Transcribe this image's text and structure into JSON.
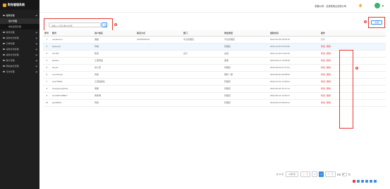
{
  "app": {
    "title": "财务管理系统"
  },
  "sidebar": {
    "items": [
      {
        "label": "权限管理",
        "open": true
      },
      {
        "label": "财务管理"
      },
      {
        "label": "采购付款管理"
      },
      {
        "label": "订单管理"
      },
      {
        "label": "采购付款管理"
      },
      {
        "label": "采购付款管理"
      },
      {
        "label": "账户管理"
      },
      {
        "label": "网站信息管理"
      },
      {
        "label": "日志管理"
      }
    ],
    "subitems": [
      {
        "label": "用户管理",
        "active": true
      },
      {
        "label": "角色权限管理"
      }
    ]
  },
  "topbar": {
    "company": "前置公司：北京精睿云测试公司"
  },
  "search": {
    "placeholder": "请输入公司名/用户/名称",
    "marker": "①"
  },
  "toolbar": {
    "add_label": "+新增",
    "marker": "③"
  },
  "table": {
    "columns": [
      "序号",
      "账号",
      "用户姓名",
      "联系方式",
      "部门",
      "角色类型",
      "更新时间",
      "操作"
    ],
    "rows": [
      {
        "idx": "1",
        "account": "caoshenen",
        "name": "谢超",
        "phone": "15555556001",
        "dept": "平台管理员",
        "role": "平台管理员",
        "time": "2024-06-05 09:28:15",
        "ops": [
          "删除"
        ],
        "disabled": true
      },
      {
        "idx": "2",
        "account": "lhghuyan",
        "name": "华毅",
        "phone": "",
        "dept": "",
        "role": "管理员",
        "time": "2024-11-25 15:20:30",
        "ops": [
          "修改",
          "删除"
        ],
        "highlight": true
      },
      {
        "idx": "3",
        "account": "chen51",
        "name": "陈思",
        "phone": "",
        "dept": "总元",
        "role": "总经",
        "time": "2024-11-25 13:03:49",
        "ops": [
          "修改",
          "删除"
        ]
      },
      {
        "idx": "4",
        "account": "jiahebo",
        "name": "江西贺铭",
        "phone": "",
        "dept": "",
        "role": "质量",
        "time": "2024-09-14 15:28:48",
        "ops": [
          "修改",
          "删除"
        ]
      },
      {
        "idx": "5",
        "account": "fenyilu",
        "name": "泰仁邦",
        "phone": "",
        "dept": "",
        "role": "管理员",
        "time": "2024-09-03 11:17:54",
        "ops": [
          "修改",
          "删除"
        ]
      },
      {
        "idx": "6",
        "account": "wenzhenjie",
        "name": "周恩",
        "phone": "",
        "dept": "",
        "role": "审核一部",
        "time": "2024-08-30 09:38:56",
        "ops": [
          "修改",
          "删除"
        ]
      },
      {
        "idx": "7",
        "account": "pcg778921",
        "name": "江西桃园队",
        "phone": "",
        "dept": "",
        "role": "管理员",
        "time": "2024-07-31 11:28:04",
        "ops": [
          "修改",
          "删除"
        ]
      },
      {
        "idx": "8",
        "account": "huangpengbodie",
        "name": "黄鹏",
        "phone": "",
        "dept": "",
        "role": "管理员",
        "time": "2024-06-20 15:17:31",
        "ops": [
          "修改",
          "删除"
        ]
      },
      {
        "idx": "9",
        "account": "hcn1987148967",
        "name": "黄伟明",
        "phone": "",
        "dept": "",
        "role": "管理员",
        "time": "2024-06-16 14:04:27",
        "ops": [
          "修改",
          "删除"
        ]
      },
      {
        "idx": "10",
        "account": "pg799921",
        "name": "周铁",
        "phone": "",
        "dept": "",
        "role": "管理员",
        "time": "2024-06-16 09:00:41",
        "ops": [
          "修改",
          "删除"
        ]
      }
    ],
    "ops_marker": "②"
  },
  "pager": {
    "total": "共 16 条",
    "page_size": "10条/页",
    "prev": "上一页",
    "pages": [
      "1",
      "2"
    ],
    "active": "2",
    "next": "下一页",
    "goto": "前往",
    "goto_value": "2",
    "goto_suffix": "页"
  },
  "colors": {
    "accent": "#3a8ee6",
    "danger": "#e53935",
    "sidebar_bg": "#1f1f1f"
  }
}
